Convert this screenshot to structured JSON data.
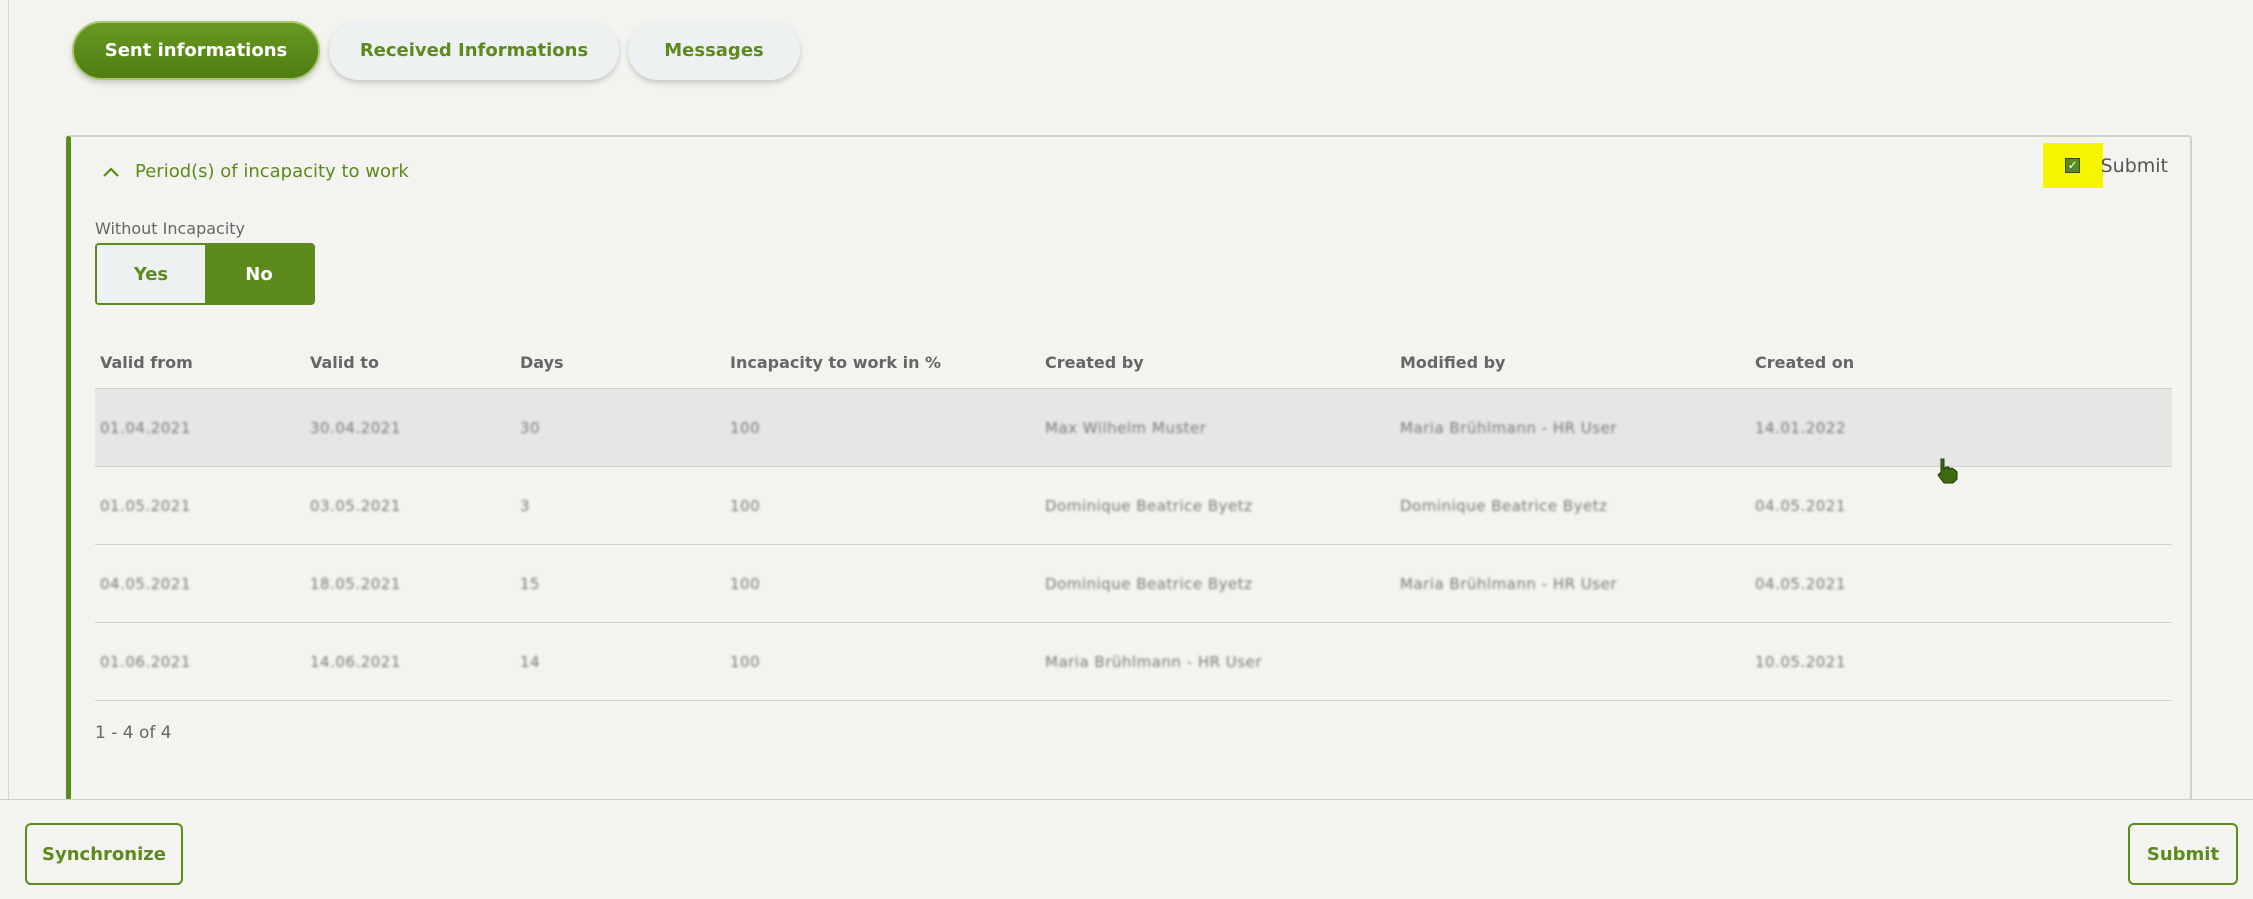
{
  "tabs": [
    {
      "label": "Sent informations",
      "active": true
    },
    {
      "label": "Received Informations",
      "active": false
    },
    {
      "label": "Messages",
      "active": false
    }
  ],
  "section": {
    "title": "Period(s) of incapacity to work",
    "expanded": true,
    "submit_checkbox_label": "Submit",
    "submit_checked": true
  },
  "without_incapacity": {
    "label": "Without Incapacity",
    "options": [
      "Yes",
      "No"
    ],
    "selected": "No"
  },
  "table": {
    "columns": [
      "Valid from",
      "Valid to",
      "Days",
      "Incapacity to work in %",
      "Created by",
      "Modified by",
      "Created on"
    ],
    "rows": [
      [
        "01.04.2021",
        "30.04.2021",
        "30",
        "100",
        "Max Wilhelm Muster",
        "Maria Brühlmann - HR User",
        "14.01.2022"
      ],
      [
        "01.05.2021",
        "03.05.2021",
        "3",
        "100",
        "Dominique Beatrice Byetz",
        "Dominique Beatrice Byetz",
        "04.05.2021"
      ],
      [
        "04.05.2021",
        "18.05.2021",
        "15",
        "100",
        "Dominique Beatrice Byetz",
        "Maria Brühlmann - HR User",
        "04.05.2021"
      ],
      [
        "01.06.2021",
        "14.06.2021",
        "14",
        "100",
        "Maria Brühlmann - HR User",
        "",
        "10.05.2021"
      ]
    ],
    "pagination": "1 - 4 of 4"
  },
  "footer": {
    "synchronize_label": "Synchronize",
    "submit_label": "Submit"
  },
  "colors": {
    "accent": "#5c8a1c",
    "highlight": "#f5f500",
    "background": "#f3f3ef"
  }
}
